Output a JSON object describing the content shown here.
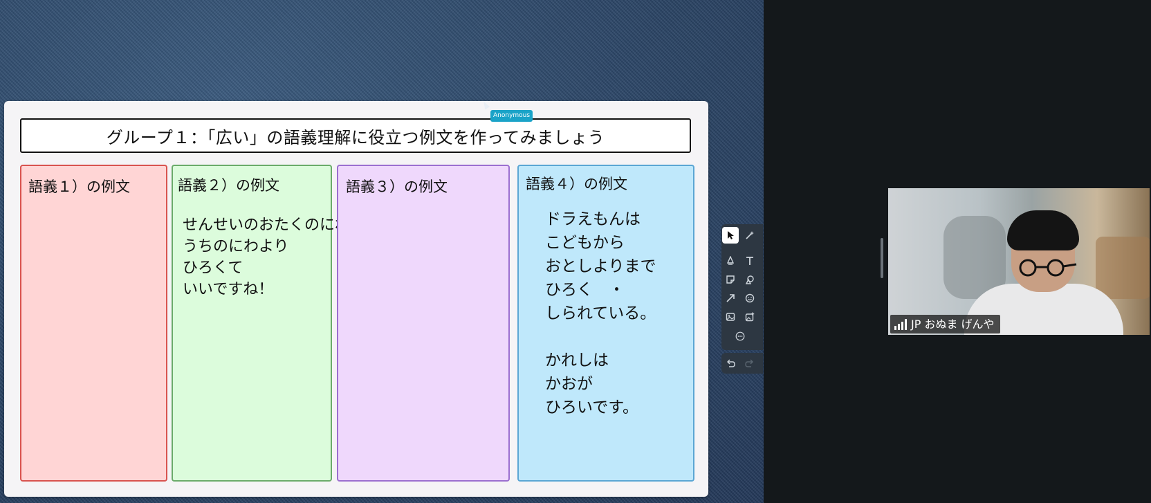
{
  "board": {
    "title": "グループ１：「広い」の語義理解に役立つ例文を作ってみましょう",
    "columns": [
      {
        "heading": "語義１）の例文",
        "body": ""
      },
      {
        "heading": "語義２）の例文",
        "body": "せんせいのおたくのにわは\nうちのにわより\nひろくて\nいいですね！"
      },
      {
        "heading": "語義３）の例文",
        "body": ""
      },
      {
        "heading": "語義４）の例文",
        "body": "ドラえもんは\nこどもから\nおとしよりまで\nひろく　・\nしられている。\n\nかれしは\nかおが\nひろいです。"
      }
    ],
    "colors": {
      "col1": "#ffd5d5",
      "col2": "#dcfcdc",
      "col3": "#efd8fc",
      "col4": "#bfe8fb"
    }
  },
  "cursor_tag": {
    "label": "Anonymous"
  },
  "toolbar": {
    "tools": [
      {
        "icon": "pointer-icon"
      },
      {
        "icon": "magic-wand-icon"
      },
      {
        "icon": "pen-icon"
      },
      {
        "icon": "text-icon"
      },
      {
        "icon": "sticky-note-icon"
      },
      {
        "icon": "shapes-icon"
      },
      {
        "icon": "arrow-icon"
      },
      {
        "icon": "sticker-icon"
      },
      {
        "icon": "image-icon"
      },
      {
        "icon": "add-image-icon"
      },
      {
        "icon": "more-icon"
      }
    ],
    "history": [
      {
        "icon": "undo-icon"
      },
      {
        "icon": "redo-icon"
      }
    ]
  },
  "video": {
    "participant_name": "JP おぬま げんや"
  }
}
